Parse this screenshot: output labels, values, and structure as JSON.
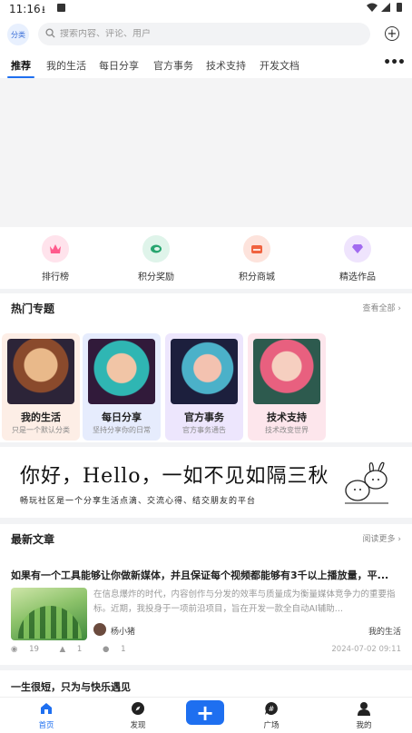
{
  "status_bar": {
    "time": "11:16"
  },
  "search": {
    "category_label": "分类",
    "placeholder": "搜索内容、评论、用户"
  },
  "tabs": [
    "推荐",
    "我的生活",
    "每日分享",
    "官方事务",
    "技术支持",
    "开发文档"
  ],
  "quick_links": [
    {
      "label": "排行榜",
      "icon": "crown-icon",
      "color": "#ff5a8c",
      "bg": "#ffe3ec"
    },
    {
      "label": "积分奖励",
      "icon": "reward-icon",
      "color": "#27a56f",
      "bg": "#dff4ea"
    },
    {
      "label": "积分商城",
      "icon": "shop-icon",
      "color": "#f0623f",
      "bg": "#fde3dc"
    },
    {
      "label": "精选作品",
      "icon": "gem-icon",
      "color": "#a26bf0",
      "bg": "#efe4fd"
    }
  ],
  "hot_topics": {
    "title": "热门专题",
    "more": "查看全部",
    "cards": [
      {
        "title": "我的生活",
        "subtitle": "只是一个默认分类",
        "bg": "#fdeee6"
      },
      {
        "title": "每日分享",
        "subtitle": "坚持分享你的日常",
        "bg": "#e6ecfd"
      },
      {
        "title": "官方事务",
        "subtitle": "官方事务通告",
        "bg": "#ede6fd"
      },
      {
        "title": "技术支持",
        "subtitle": "技术改变世界",
        "bg": "#fde6ec"
      }
    ]
  },
  "welcome": {
    "headline": "你好，Hello，一如不见如隔三秋",
    "subline": "畅玩社区是一个分享生活点滴、交流心得、结交朋友的平台"
  },
  "latest": {
    "title": "最新文章",
    "more": "阅读更多",
    "article": {
      "title": "如果有一个工具能够让你做新媒体，并且保证每个视频都能够有3千以上播放量，平...",
      "excerpt": "在信息爆炸的时代，内容创作与分发的效率与质量成为衡量媒体竞争力的重要指标。近期，我投身于一项前沿项目，旨在开发一款全自动AI辅助...",
      "author": "杨小猪",
      "category": "我的生活",
      "views": "19",
      "likes": "1",
      "comments": "1",
      "date": "2024-07-02 09:11"
    },
    "article2_title": "一生很短，只为与快乐遇见"
  },
  "bottom_nav": [
    {
      "label": "首页",
      "icon": "home-icon",
      "active": true
    },
    {
      "label": "发现",
      "icon": "compass-icon"
    },
    {
      "label": "广场",
      "icon": "square-icon"
    },
    {
      "label": "我的",
      "icon": "user-icon"
    }
  ],
  "colors": {
    "accent": "#1e6ff0"
  }
}
